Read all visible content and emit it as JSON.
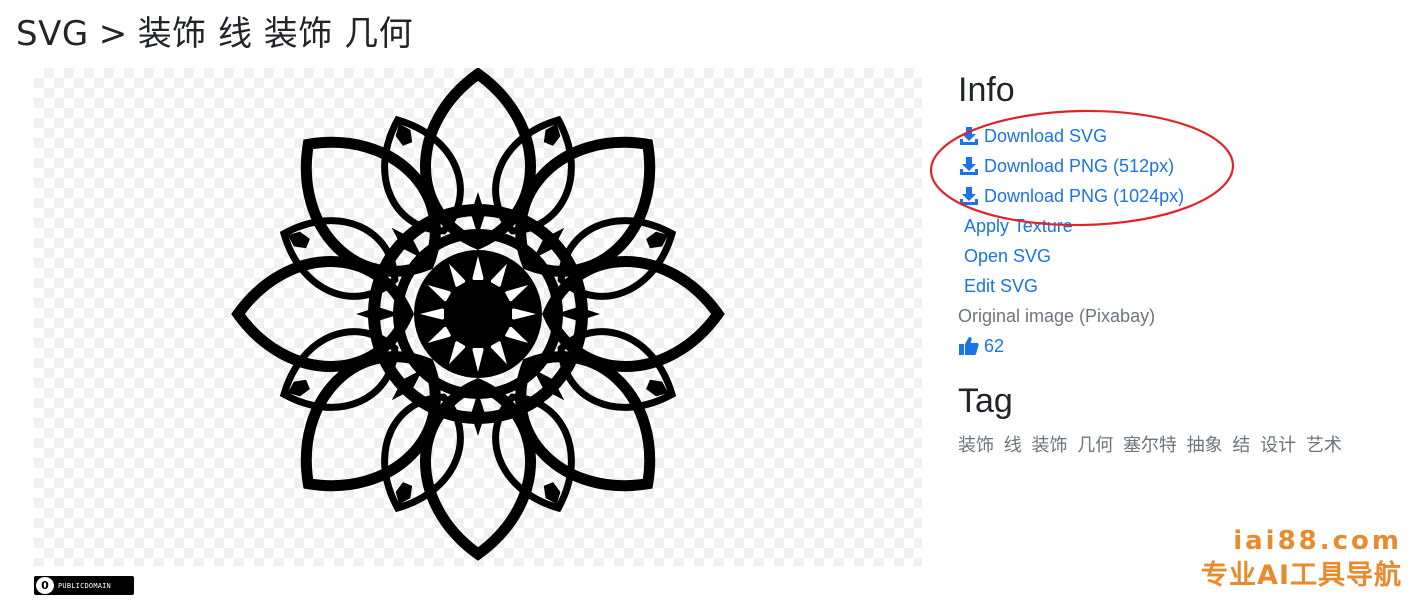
{
  "breadcrumb": {
    "root": "SVG",
    "separator": ">",
    "current": "装饰 线 装饰 几何"
  },
  "preview": {
    "image": "celtic-knot-mandala",
    "license_icon": "cc-icon",
    "license_text": "PUBLICDOMAIN"
  },
  "info": {
    "heading": "Info",
    "download_svg": "Download SVG",
    "download_png_512": "Download PNG (512px)",
    "download_png_1024": "Download PNG (1024px)",
    "apply_texture": "Apply Texture",
    "open_svg": "Open SVG",
    "edit_svg": "Edit SVG",
    "original_image": "Original image (Pixabay)",
    "likes": "62"
  },
  "tag": {
    "heading": "Tag",
    "items": [
      "装饰",
      "线",
      "装饰",
      "几何",
      "塞尔特",
      "抽象",
      "结",
      "设计",
      "艺术"
    ]
  },
  "watermark": {
    "domain": "iai88.com",
    "slogan": "专业AI工具导航"
  },
  "colors": {
    "link": "#1a73e8",
    "annotation": "#e0242a",
    "watermark": "#e98a2c",
    "muted": "#6c757d"
  }
}
